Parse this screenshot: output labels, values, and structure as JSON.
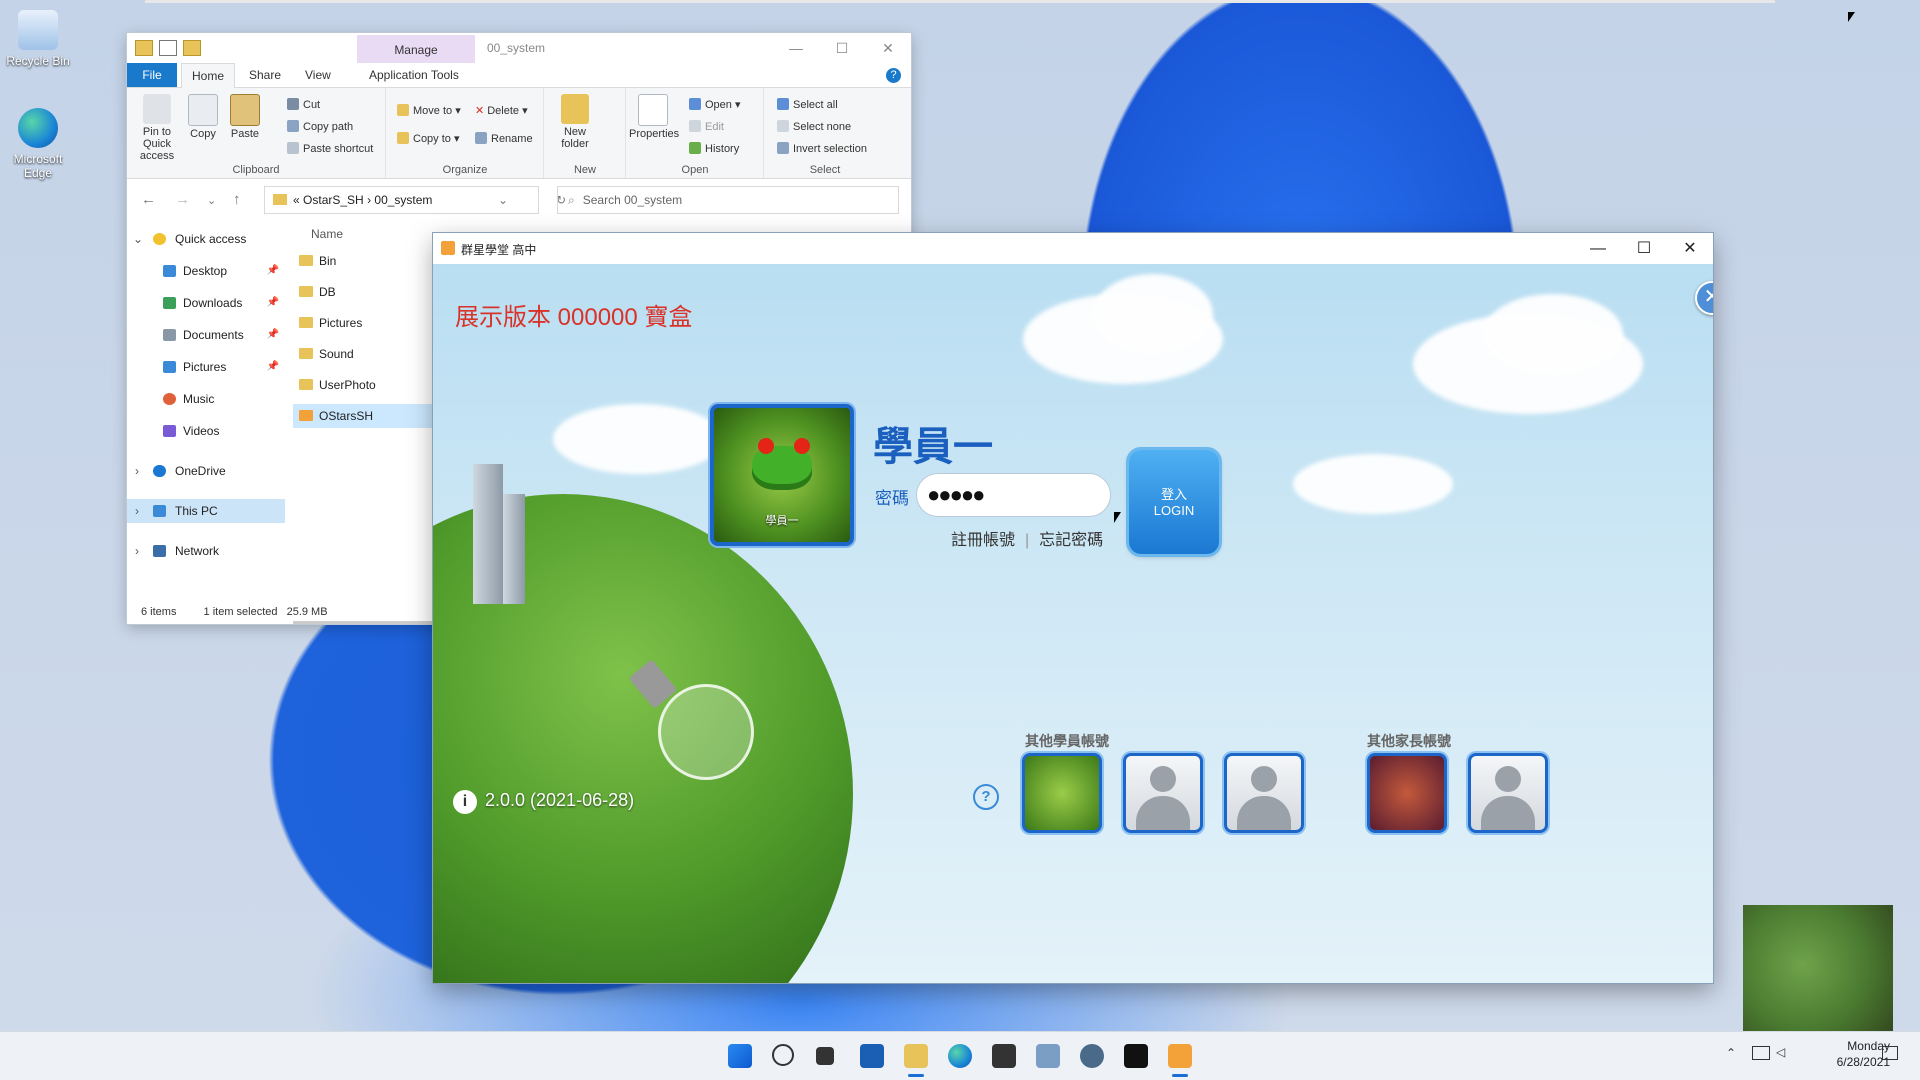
{
  "desktop": {
    "icons": [
      {
        "label": "Recycle Bin"
      },
      {
        "label": "Microsoft Edge"
      }
    ]
  },
  "explorer": {
    "manage_tab": "Manage",
    "window_title": "00_system",
    "tabs": [
      "File",
      "Home",
      "Share",
      "View",
      "Application Tools"
    ],
    "ribbon": {
      "clipboard": {
        "label": "Clipboard",
        "pin": "Pin to Quick access",
        "copy": "Copy",
        "paste": "Paste",
        "cut": "Cut",
        "copy_path": "Copy path",
        "paste_shortcut": "Paste shortcut"
      },
      "organize": {
        "label": "Organize",
        "move_to": "Move to",
        "copy_to": "Copy to",
        "delete": "Delete",
        "rename": "Rename"
      },
      "new": {
        "label": "New",
        "new_folder": "New folder"
      },
      "open": {
        "label": "Open",
        "properties": "Properties",
        "open": "Open",
        "edit": "Edit",
        "history": "History"
      },
      "select": {
        "label": "Select",
        "select_all": "Select all",
        "select_none": "Select none",
        "invert": "Invert selection"
      }
    },
    "address": {
      "prefix": "«",
      "crumb1": "OstarS_SH",
      "sep": "›",
      "crumb2": "00_system"
    },
    "search_placeholder": "Search 00_system",
    "nav": [
      {
        "label": "Quick access"
      },
      {
        "label": "Desktop"
      },
      {
        "label": "Downloads"
      },
      {
        "label": "Documents"
      },
      {
        "label": "Pictures"
      },
      {
        "label": "Music"
      },
      {
        "label": "Videos"
      },
      {
        "label": "OneDrive"
      },
      {
        "label": "This PC"
      },
      {
        "label": "Network"
      }
    ],
    "column_name": "Name",
    "files": [
      "Bin",
      "DB",
      "Pictures",
      "Sound",
      "UserPhoto",
      "OStarsSH"
    ],
    "status": {
      "items": "6 items",
      "selected": "1 item selected",
      "size": "25.9 MB"
    }
  },
  "app": {
    "title": "群星學堂 高中",
    "demo_label": "展示版本 000000 寶盒",
    "user_name": "學員一",
    "avatar_caption": "學員一",
    "password_label": "密碼",
    "password_value": "●●●●●",
    "register_link": "註冊帳號",
    "link_sep": "|",
    "forgot_link": "忘記密碼",
    "login_cn": "登入",
    "login_en": "LOGIN",
    "other_students_label": "其他學員帳號",
    "other_parents_label": "其他家長帳號",
    "help": "?",
    "info": "i",
    "version": "2.0.0 (2021-06-28)",
    "close": "✕"
  },
  "taskbar": {
    "clock_day": "Monday",
    "clock_date": "6/28/2021"
  },
  "colors": {
    "accent_blue": "#1b5fbf",
    "demo_red": "#d93329",
    "file_tab": "#1979ca"
  }
}
